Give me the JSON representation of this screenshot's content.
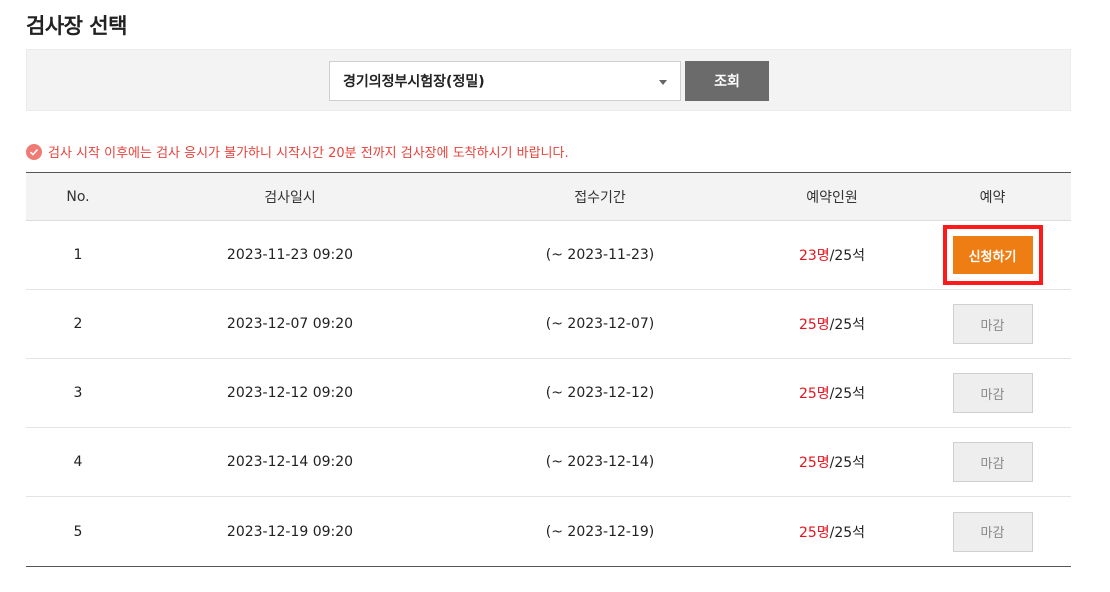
{
  "page_title": "검사장 선택",
  "search": {
    "selected_site": "경기의정부시험장(정밀)",
    "button_label": "조회"
  },
  "notice": "검사 시작 이후에는 검사 응시가 불가하니 시작시간 20분 전까지 검사장에 도착하시기 바랍니다.",
  "table": {
    "headers": [
      "No.",
      "검사일시",
      "접수기간",
      "예약인원",
      "예약"
    ],
    "rows": [
      {
        "no": "1",
        "datetime": "2023-11-23 09:20",
        "period": "(~ 2023-11-23)",
        "booked": "23명",
        "capacity": "/25석",
        "action": "신청하기",
        "status": "open"
      },
      {
        "no": "2",
        "datetime": "2023-12-07 09:20",
        "period": "(~ 2023-12-07)",
        "booked": "25명",
        "capacity": "/25석",
        "action": "마감",
        "status": "closed"
      },
      {
        "no": "3",
        "datetime": "2023-12-12 09:20",
        "period": "(~ 2023-12-12)",
        "booked": "25명",
        "capacity": "/25석",
        "action": "마감",
        "status": "closed"
      },
      {
        "no": "4",
        "datetime": "2023-12-14 09:20",
        "period": "(~ 2023-12-14)",
        "booked": "25명",
        "capacity": "/25석",
        "action": "마감",
        "status": "closed"
      },
      {
        "no": "5",
        "datetime": "2023-12-19 09:20",
        "period": "(~ 2023-12-19)",
        "booked": "25명",
        "capacity": "/25석",
        "action": "마감",
        "status": "closed"
      }
    ]
  },
  "colors": {
    "accent_orange": "#ee7d13",
    "booked_red": "#e5141e",
    "notice_red": "#e8423b",
    "highlight_red": "#ff1a1a"
  }
}
